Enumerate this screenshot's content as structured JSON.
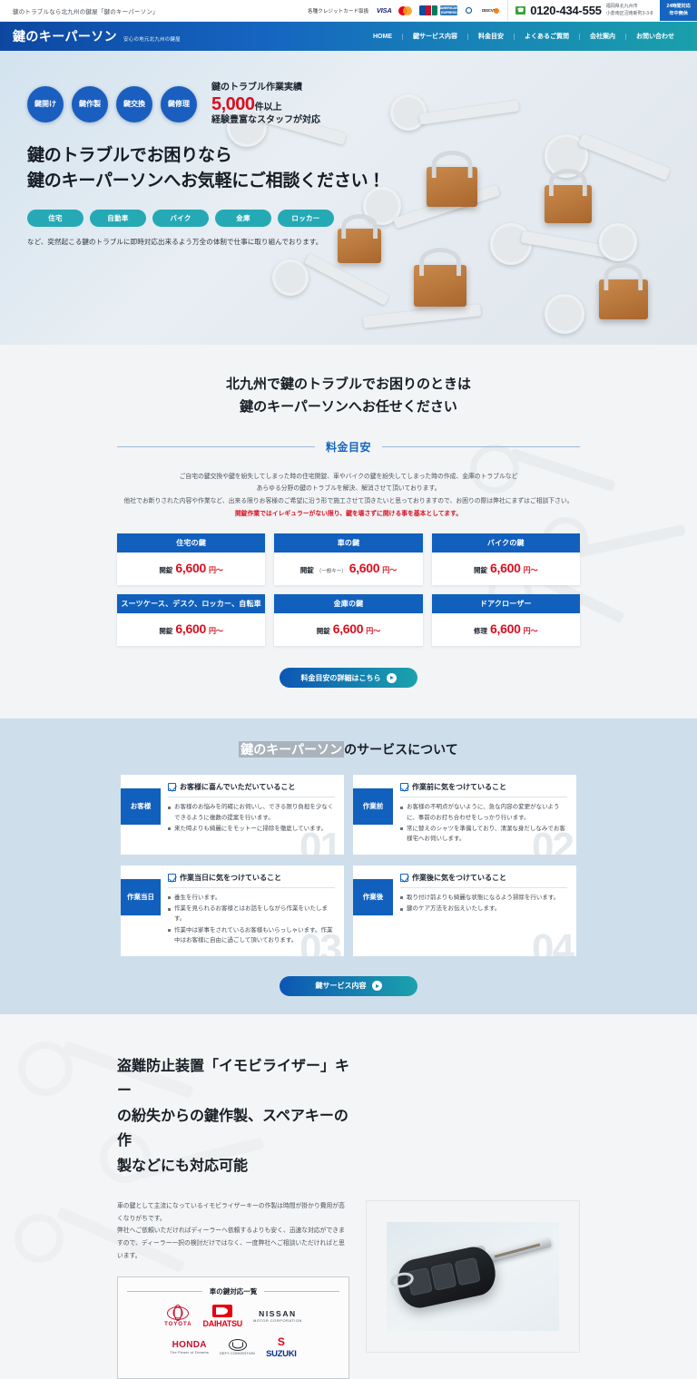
{
  "topbar": {
    "tagline": "鍵のトラブルなら北九州の鍵屋「鍵のキーパーソン」",
    "credit_label": "各種クレジットカード取扱",
    "cards": [
      "VISA",
      "Mastercard",
      "JCB",
      "AMEX",
      "Diners Club",
      "DISCOVER"
    ],
    "phone": "0120-434-555",
    "address_line1": "福岡県北九州市",
    "address_line2": "小倉南区沼南新町3-3-8",
    "hours_line1": "24時間対応",
    "hours_line2": "年中無休"
  },
  "nav": {
    "brand_name": "鍵のキーパーソン",
    "brand_sub": "安心の地元北九州の鍵屋",
    "links": [
      {
        "label": "HOME"
      },
      {
        "label": "鍵サービス内容"
      },
      {
        "label": "料金目安"
      },
      {
        "label": "よくあるご質問"
      },
      {
        "label": "会社案内"
      },
      {
        "label": "お問い合わせ"
      }
    ]
  },
  "hero": {
    "badges": [
      "鍵開け",
      "鍵作製",
      "鍵交換",
      "鍵修理"
    ],
    "stat_top": "鍵のトラブル作業実績",
    "stat_number": "5,000",
    "stat_unit": "件以上",
    "stat_bottom": "経験豊富なスタッフが対応",
    "headline_line1": "鍵のトラブルでお困りなら",
    "headline_line2": "鍵のキーパーソンへお気軽にご相談ください！",
    "tags": [
      "住宅",
      "自動車",
      "バイク",
      "金庫",
      "ロッカー"
    ],
    "note": "など、突然起こる鍵のトラブルに即時対応出来るよう万全の体制で仕事に取り組んでおります。"
  },
  "pricing": {
    "heading_line1": "北九州で鍵のトラブルでお困りのときは",
    "heading_line2": "鍵のキーパーソンへお任せください",
    "divider_label": "料金目安",
    "copy_line1": "ご自宅の鍵交換や鍵を紛失してしまった時の住宅開錠、車やバイクの鍵を紛失してしまった時の作成、金庫のトラブルなど",
    "copy_line2": "あらゆる分野の鍵のトラブルを解決、解消させて頂いております。",
    "copy_line3": "他社でお断りされた内容や作業など、出来る限りお客様のご希望に沿う形で施工させて頂きたいと思っておりますので、お困りの際は弊社にまずはご相談下さい。",
    "copy_highlight": "開錠作業ではイレギュラーがない限り、鍵を壊さずに開ける事を基本としてます。",
    "cards": [
      {
        "title": "住宅の鍵",
        "label": "開錠",
        "sub": "",
        "amount": "6,600",
        "yen": "円〜"
      },
      {
        "title": "車の鍵",
        "label": "開錠",
        "sub": "（一般キー）",
        "amount": "6,600",
        "yen": "円〜"
      },
      {
        "title": "バイクの鍵",
        "label": "開錠",
        "sub": "",
        "amount": "6,600",
        "yen": "円〜"
      },
      {
        "title": "スーツケース、デスク、ロッカー、自転車",
        "label": "開錠",
        "sub": "",
        "amount": "6,600",
        "yen": "円〜"
      },
      {
        "title": "金庫の鍵",
        "label": "開錠",
        "sub": "",
        "amount": "6,600",
        "yen": "円〜"
      },
      {
        "title": "ドアクローザー",
        "label": "修理",
        "sub": "",
        "amount": "6,600",
        "yen": "円〜"
      }
    ],
    "cta_label": "料金目安の詳細はこちら"
  },
  "services": {
    "title_mark": "鍵のキーパーソン",
    "title_rest": "のサービスについて",
    "cards": [
      {
        "tab": "お客様",
        "heading": "お客様に喜んでいただいていること",
        "items": [
          "お客様のお悩みを的確にお伺いし、できる限り負担を少なくできるように複数の提案を行います。",
          "来た時よりも綺麗にをモットーに掃除を徹底しています。"
        ],
        "number": "01"
      },
      {
        "tab": "作業前",
        "heading": "作業前に気をつけていること",
        "items": [
          "お客様の不明点がないように、急な内容の変更がないように、事前のお打ち合わせをしっかり行います。",
          "常に替えのシャツを準備しており、清潔な身だしなみでお客様宅へお伺いします。"
        ],
        "number": "02"
      },
      {
        "tab": "作業当日",
        "heading": "作業当日に気をつけていること",
        "items": [
          "養生を行います。",
          "作業を見られるお客様とはお話をしながら作業をいたします。",
          "作業中は家事をされているお客様もいらっしゃいます。作業中はお客様に自由に過ごして頂いております。"
        ],
        "number": "03"
      },
      {
        "tab": "作業後",
        "heading": "作業後に気をつけていること",
        "items": [
          "取り付け前よりも綺麗な状態になるよう掃除を行います。",
          "鍵のケア方法をお伝えいたします。"
        ],
        "number": "04"
      }
    ],
    "cta_label": "鍵サービス内容"
  },
  "immobilizer": {
    "heading_line1": "盗難防止装置「イモビライザー」キー",
    "heading_line2": "の紛失からの鍵作製、スペアキーの作",
    "heading_line3": "製などにも対応可能",
    "copy_line1": "車の鍵として主流になっているイモビライザーキーの作製は時間が掛かり費用が高くなりがちです。",
    "copy_line2": "弊社へご依頼いただければディーラーへ依頼するよりも安く、迅速な対応ができますので、ディーラー一択の検討だけではなく、一度弊社へご相談いただければと思います。",
    "brands_title": "車の鍵対応一覧",
    "brands_row1": [
      {
        "name": "TOYOTA"
      },
      {
        "name": "DAIHATSU"
      },
      {
        "name": "NISSAN",
        "sub": "MOTOR CORPORATION"
      }
    ],
    "brands_row2": [
      {
        "name": "HONDA",
        "sub": "The Power of Dreams"
      },
      {
        "name": "MAZDA",
        "sub": "DEFY CONVENTION"
      },
      {
        "name": "SUZUKI"
      }
    ]
  },
  "colors": {
    "brand_blue": "#1160bd",
    "brand_teal": "#19a0ac",
    "accent_red": "#d81020",
    "nav_gradient_start": "#0d47a1",
    "nav_gradient_end": "#19a0ac"
  }
}
